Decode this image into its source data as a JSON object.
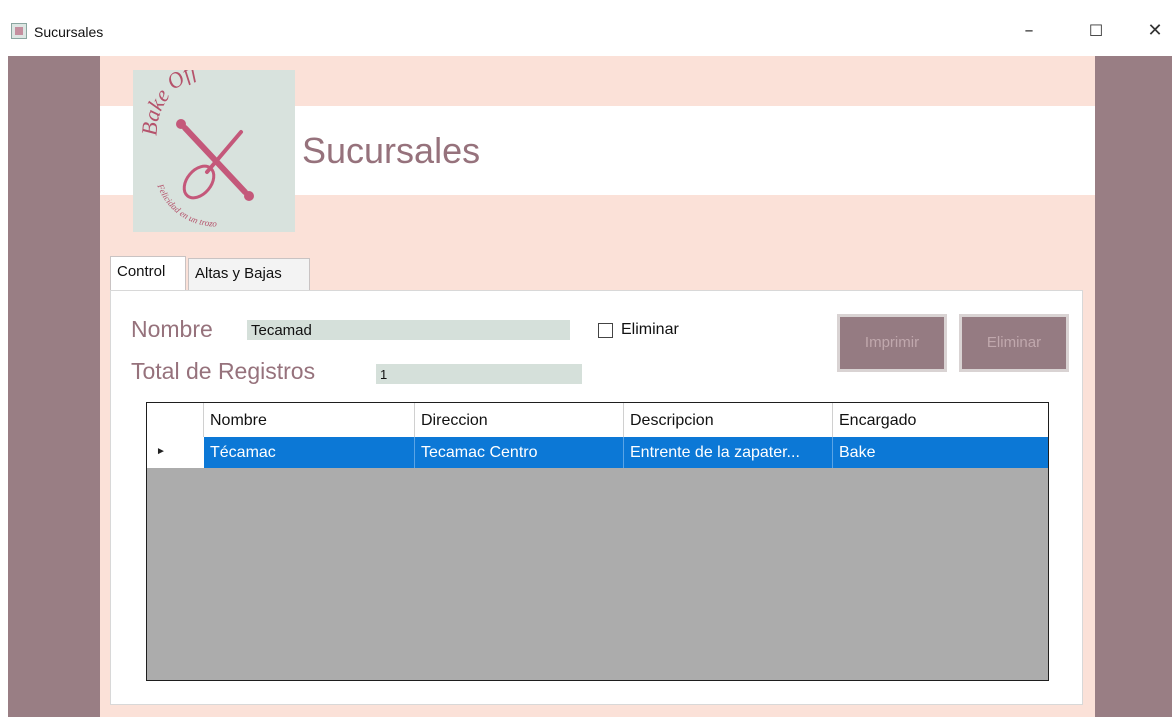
{
  "window": {
    "title": "Sucursales",
    "minimize_glyph": "–",
    "maximize_glyph": "☐",
    "close_glyph": "✕"
  },
  "logo": {
    "brand_text": "Bake Off",
    "tagline": "Felicidad en un trozo",
    "icon": "crossed-whisk-and-rolling-pin"
  },
  "header": {
    "title": "Sucursales"
  },
  "tabs": [
    {
      "label": "Control",
      "selected": true
    },
    {
      "label": "Altas y Bajas",
      "selected": false
    }
  ],
  "form": {
    "nombre_label": "Nombre",
    "nombre_value": "Tecamad",
    "total_label": "Total de Registros",
    "total_value": "1",
    "eliminar_check_label": "Eliminar",
    "eliminar_checked": false,
    "imprimir_label": "Imprimir",
    "eliminar_button_label": "Eliminar"
  },
  "grid": {
    "columns": [
      "Nombre",
      "Direccion",
      "Descripcion",
      "Encargado"
    ],
    "row_indicator": "►",
    "rows": [
      [
        "Técamac",
        "Tecamac Centro",
        "Entrente de la zapater...",
        "Bake"
      ]
    ]
  },
  "colors": {
    "accent_mauve": "#96727c",
    "panel_peach": "#fbe1d8",
    "frame_mauve": "#997e84",
    "field_mint": "#d5e0da",
    "selection_blue": "#0c78d6",
    "grid_empty_gray": "#acacac"
  }
}
